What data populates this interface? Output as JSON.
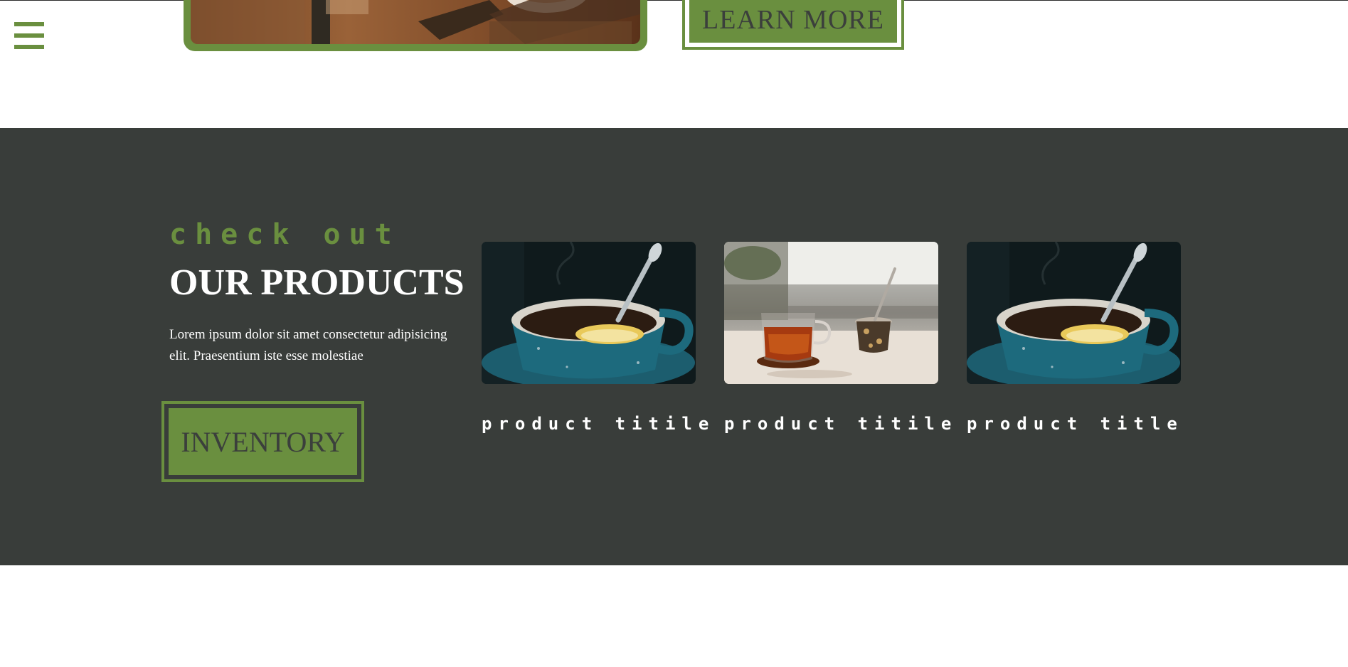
{
  "nav": {
    "menu_icon": "hamburger-menu-icon"
  },
  "hero": {
    "learn_more_label": "LEARN MORE"
  },
  "products_section": {
    "eyebrow": "check out",
    "title": "OUR PRODUCTS",
    "description": "Lorem ipsum dolor sit amet consectetur adipisicing elit. Praesentium iste esse molestiae",
    "inventory_label": "INVENTORY",
    "cards": [
      {
        "title": "product titile"
      },
      {
        "title": "product titile"
      },
      {
        "title": "product title"
      }
    ]
  },
  "colors": {
    "accent_green": "#6a8f3f",
    "section_dark": "#393d3a",
    "button_text": "#3b3f3c"
  }
}
